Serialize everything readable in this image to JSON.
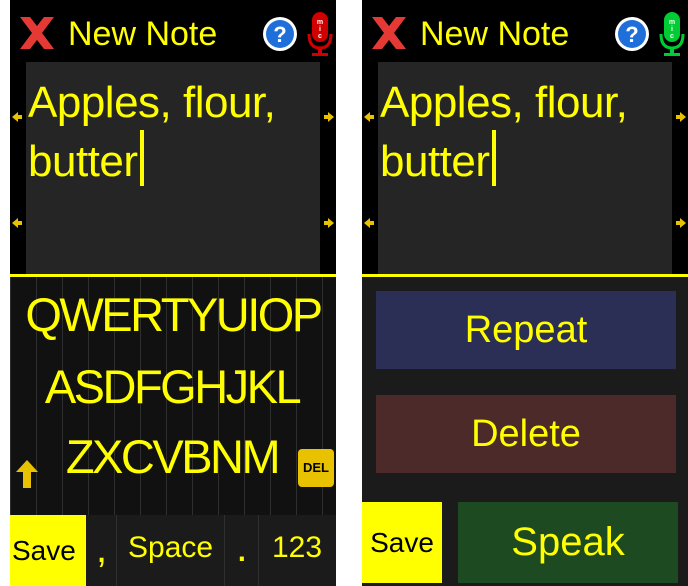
{
  "colors": {
    "accent": "#ffff00",
    "background": "#1b1b1b",
    "topbar": "#000000",
    "close_icon": "#e53935",
    "help_icon": "#1e6fd9",
    "mic_inactive": "#d00000",
    "mic_active": "#00cc33",
    "repeat_button": "#2b2f55",
    "delete_button": "#4c2a2a",
    "speak_button": "#1e4a22"
  },
  "left": {
    "title": "New Note",
    "note_text": "Apples, flour, butter",
    "mic_state": "inactive",
    "icons": [
      "close-icon",
      "help-icon",
      "mic-icon"
    ],
    "keyboard": {
      "row1": "QWERTYUIOP",
      "row2": "ASDFGHJKL",
      "row3": "ZXCVBNM",
      "del_label": "DEL",
      "save_label": "Save",
      "comma_label": ",",
      "space_label": "Space",
      "period_label": ".",
      "num_label": "123"
    }
  },
  "right": {
    "title": "New Note",
    "note_text": "Apples, flour, butter",
    "mic_state": "active",
    "icons": [
      "close-icon",
      "help-icon",
      "mic-icon"
    ],
    "buttons": {
      "repeat_label": "Repeat",
      "delete_label": "Delete",
      "save_label": "Save",
      "speak_label": "Speak"
    }
  }
}
